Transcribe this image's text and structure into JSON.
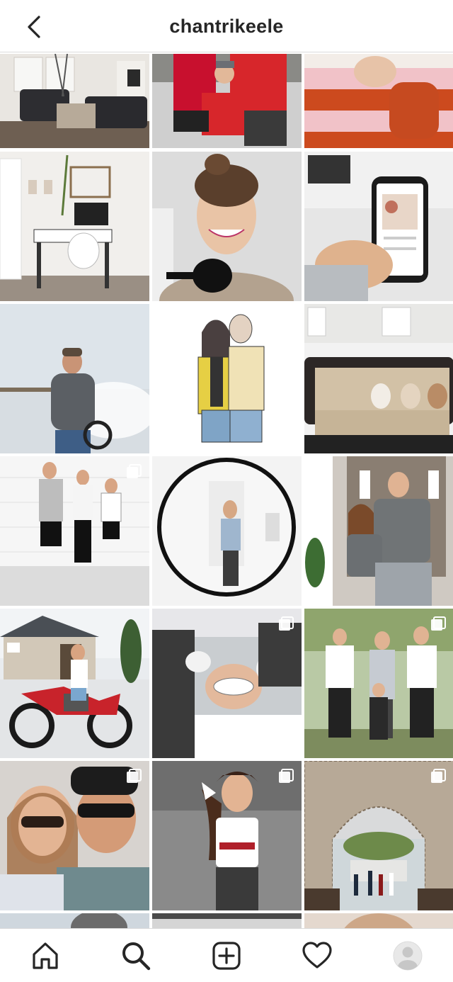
{
  "header": {
    "username": "chantrikeele",
    "back_icon": "chevron-left-icon"
  },
  "grid": {
    "rows": [
      [
        {
          "subject": "living-room",
          "multi": false
        },
        {
          "subject": "family-red-shirts",
          "multi": false
        },
        {
          "subject": "sweater-closeup",
          "multi": false
        }
      ],
      [
        {
          "subject": "home-office",
          "multi": false
        },
        {
          "subject": "podcast-selfie",
          "multi": false
        },
        {
          "subject": "phone-podcast",
          "multi": false
        }
      ],
      [
        {
          "subject": "man-outdoors",
          "multi": false
        },
        {
          "subject": "couple-illustration",
          "multi": true
        },
        {
          "subject": "couch-bunnies",
          "multi": false
        }
      ],
      [
        {
          "subject": "kids-back-to-school",
          "multi": true
        },
        {
          "subject": "round-mirror",
          "multi": false
        },
        {
          "subject": "teens-wired-up",
          "multi": false
        }
      ],
      [
        {
          "subject": "dirt-bike",
          "multi": false
        },
        {
          "subject": "dentist",
          "multi": true
        },
        {
          "subject": "family-formal",
          "multi": true
        }
      ],
      [
        {
          "subject": "couple-selfie",
          "multi": true
        },
        {
          "subject": "cheerleader",
          "multi": true
        },
        {
          "subject": "antler-arch",
          "multi": true
        }
      ],
      [
        {
          "subject": "partial-1",
          "multi": false
        },
        {
          "subject": "partial-2",
          "multi": false
        },
        {
          "subject": "partial-3",
          "multi": false
        }
      ]
    ]
  },
  "tabbar": {
    "tabs": [
      {
        "name": "home",
        "icon": "home-icon"
      },
      {
        "name": "search",
        "icon": "search-icon",
        "active": true
      },
      {
        "name": "new-post",
        "icon": "plus-square-icon"
      },
      {
        "name": "activity",
        "icon": "heart-icon"
      },
      {
        "name": "profile",
        "icon": "avatar-icon"
      }
    ]
  },
  "colors": {
    "text": "#262626",
    "divider": "#dbdbdb",
    "background": "#ffffff"
  }
}
